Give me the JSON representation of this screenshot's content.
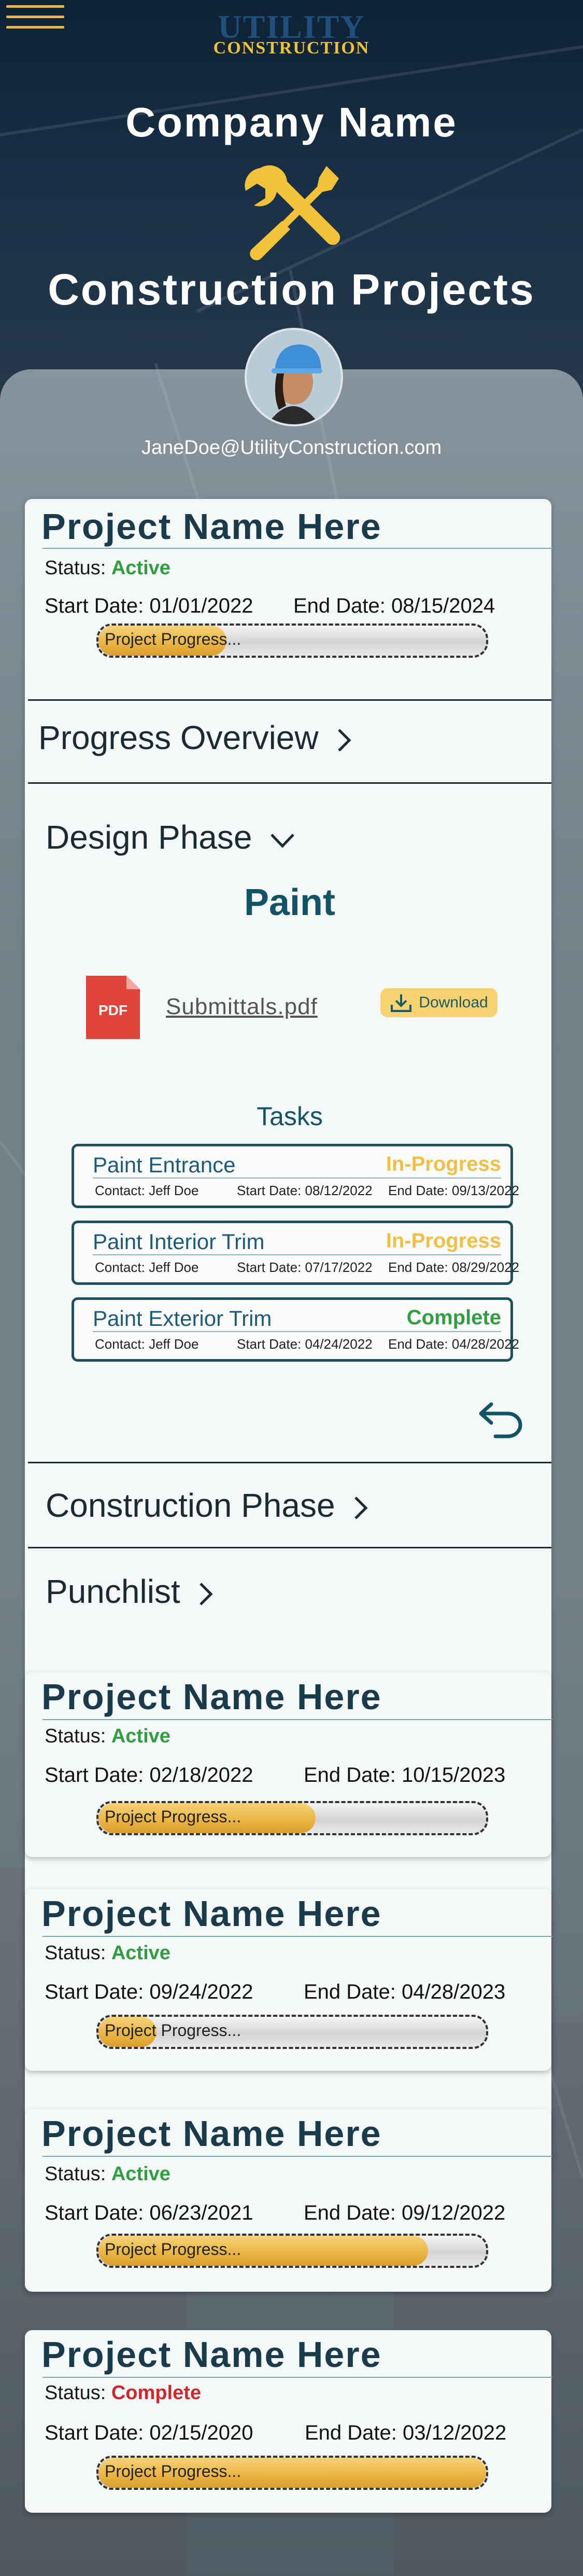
{
  "header": {
    "logo_top": "UTILITY",
    "logo_bottom": "CONSTRUCTION",
    "company_name": "Company Name",
    "page_title": "Construction Projects",
    "user_email": "JaneDoe@UtilityConstruction.com"
  },
  "icons": {
    "menu": "hamburger-menu-icon",
    "tools": "wrench-screwdriver-icon",
    "pdf": "pdf-file-icon",
    "download": "download-icon",
    "back": "undo-arrow-icon",
    "chevron_right": "chevron-right-icon",
    "chevron_down": "chevron-down-icon"
  },
  "colors": {
    "accent_gold": "#e8b84a",
    "teal": "#125366",
    "active_green": "#2e9e3e",
    "complete_red": "#d0282a",
    "inprogress_yellow": "#f2be44"
  },
  "labels": {
    "status_label": "Status:",
    "start_label": "Start Date:",
    "end_label": "End Date:",
    "progress_text": "Project Progress..."
  },
  "expanded_project": {
    "name": "Project Name Here",
    "status": "Active",
    "start": "01/01/2022",
    "end": "08/15/2024",
    "progress": 0.33,
    "sections": {
      "overview": "Progress Overview",
      "design": "Design Phase",
      "construction": "Construction Phase",
      "punchlist": "Punchlist"
    },
    "design_phase": {
      "category": "Paint",
      "file_badge": "PDF",
      "file_name": "Submittals.pdf",
      "download_label": "Download",
      "tasks_title": "Tasks",
      "contact_label": "Contact:",
      "start_label": "Start Date:",
      "end_label": "End Date:",
      "tasks": [
        {
          "name": "Paint Entrance",
          "status": "In-Progress",
          "contact": "Jeff Doe",
          "start": "08/12/2022",
          "end": "09/13/2022"
        },
        {
          "name": "Paint Interior Trim",
          "status": "In-Progress",
          "contact": "Jeff Doe",
          "start": "07/17/2022",
          "end": "08/29/2022"
        },
        {
          "name": "Paint Exterior Trim",
          "status": "Complete",
          "contact": "Jeff Doe",
          "start": "04/24/2022",
          "end": "04/28/2022"
        }
      ]
    }
  },
  "projects": [
    {
      "name": "Project Name Here",
      "status": "Active",
      "start": "02/18/2022",
      "end": "10/15/2023",
      "progress": 0.56
    },
    {
      "name": "Project Name Here",
      "status": "Active",
      "start": "09/24/2022",
      "end": "04/28/2023",
      "progress": 0.15
    },
    {
      "name": "Project Name Here",
      "status": "Active",
      "start": "06/23/2021",
      "end": "09/12/2022",
      "progress": 0.85
    },
    {
      "name": "Project Name Here",
      "status": "Complete",
      "start": "02/15/2020",
      "end": "03/12/2022",
      "progress": 1.0
    }
  ]
}
